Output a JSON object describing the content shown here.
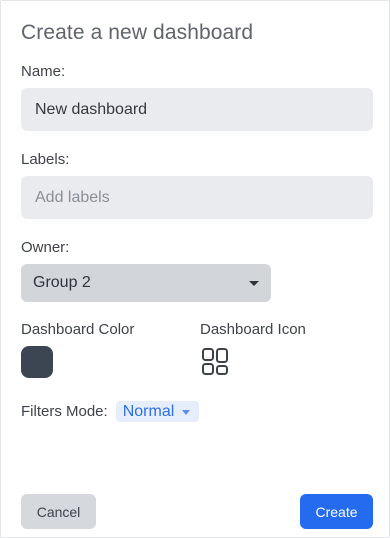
{
  "dialog": {
    "title": "Create a new dashboard"
  },
  "name_field": {
    "label": "Name:",
    "value": "New dashboard"
  },
  "labels_field": {
    "label": "Labels:",
    "placeholder": "Add labels"
  },
  "owner_field": {
    "label": "Owner:",
    "selected": "Group 2"
  },
  "color_field": {
    "label": "Dashboard Color",
    "value": "#3b4652"
  },
  "icon_field": {
    "label": "Dashboard Icon",
    "icon": "grid-icon"
  },
  "filters": {
    "label": "Filters Mode:",
    "selected": "Normal"
  },
  "actions": {
    "cancel_label": "Cancel",
    "create_label": "Create"
  },
  "colors": {
    "accent": "#246bf0"
  }
}
